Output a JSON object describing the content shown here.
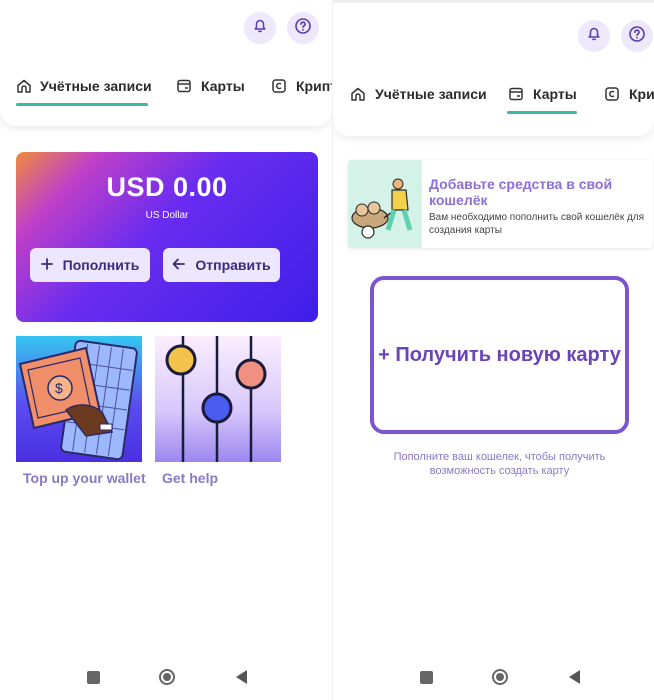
{
  "tabs": [
    {
      "label": "Учётные записи",
      "icon": "home-icon"
    },
    {
      "label": "Карты",
      "icon": "card-icon"
    },
    {
      "label": "Крипт",
      "icon": "crypto-icon"
    }
  ],
  "right_tabs": [
    {
      "label": "Учётные записи",
      "icon": "home-icon"
    },
    {
      "label": "Карты",
      "icon": "card-icon"
    },
    {
      "label": "Кри",
      "icon": "crypto-icon"
    }
  ],
  "header_icons": {
    "notifications": "bell-icon",
    "help": "question-icon"
  },
  "colors": {
    "accent": "#3bb8a8",
    "purple": "#7a55cf",
    "label_purple": "#8a78c8"
  },
  "balance": {
    "amount": "USD 0.00",
    "currency_name": "US Dollar",
    "topup_label": "Пополнить",
    "send_label": "Отправить"
  },
  "tiles": [
    {
      "label": "Top up your wallet"
    },
    {
      "label": "Get help"
    }
  ],
  "promo": {
    "title": "Добавьте средства в свой кошелёк",
    "text": "Вам необходимо пополнить свой кошелёк для создания карты"
  },
  "new_card": {
    "label": "+ Получить новую карту",
    "hint": "Пополните ваш кошелек, чтобы получить возможность создать карту"
  },
  "active_tab_left": "Учётные записи",
  "active_tab_right": "Карты"
}
